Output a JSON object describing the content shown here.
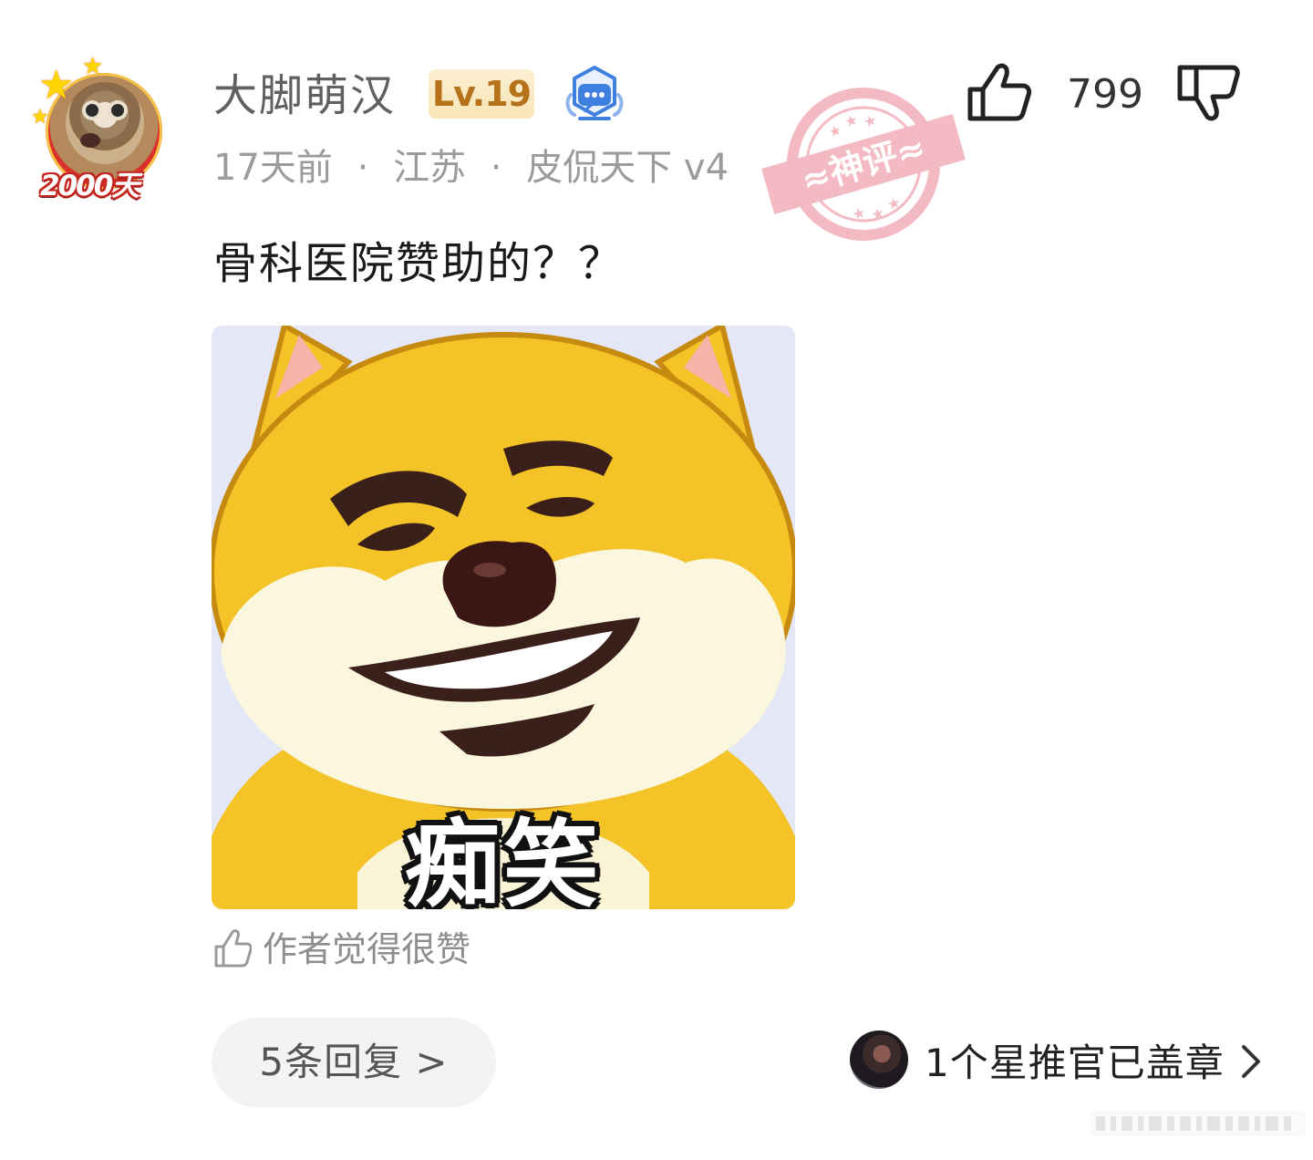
{
  "user": {
    "name": "大脚萌汉",
    "level": "Lv.19",
    "avatar_badge": "2000天"
  },
  "meta": {
    "time": "17天前",
    "location": "江苏",
    "title": "皮侃天下 v4",
    "separator": "·"
  },
  "stamp": {
    "text": "≈神评≈",
    "color": "#f3b3bd"
  },
  "actions": {
    "like_count": "799"
  },
  "comment": {
    "text": "骨科医院赞助的？？"
  },
  "meme": {
    "caption": "痴笑"
  },
  "author_like": {
    "text": "作者觉得很赞"
  },
  "replies": {
    "label": "5条回复 >"
  },
  "star_officer": {
    "text": "1个星推官已盖章"
  },
  "colors": {
    "meta_gray": "#9b9b9b",
    "level_bg": "#fdf1d3",
    "level_text": "#b7731c",
    "honor_blue": "#3f7fe0"
  }
}
